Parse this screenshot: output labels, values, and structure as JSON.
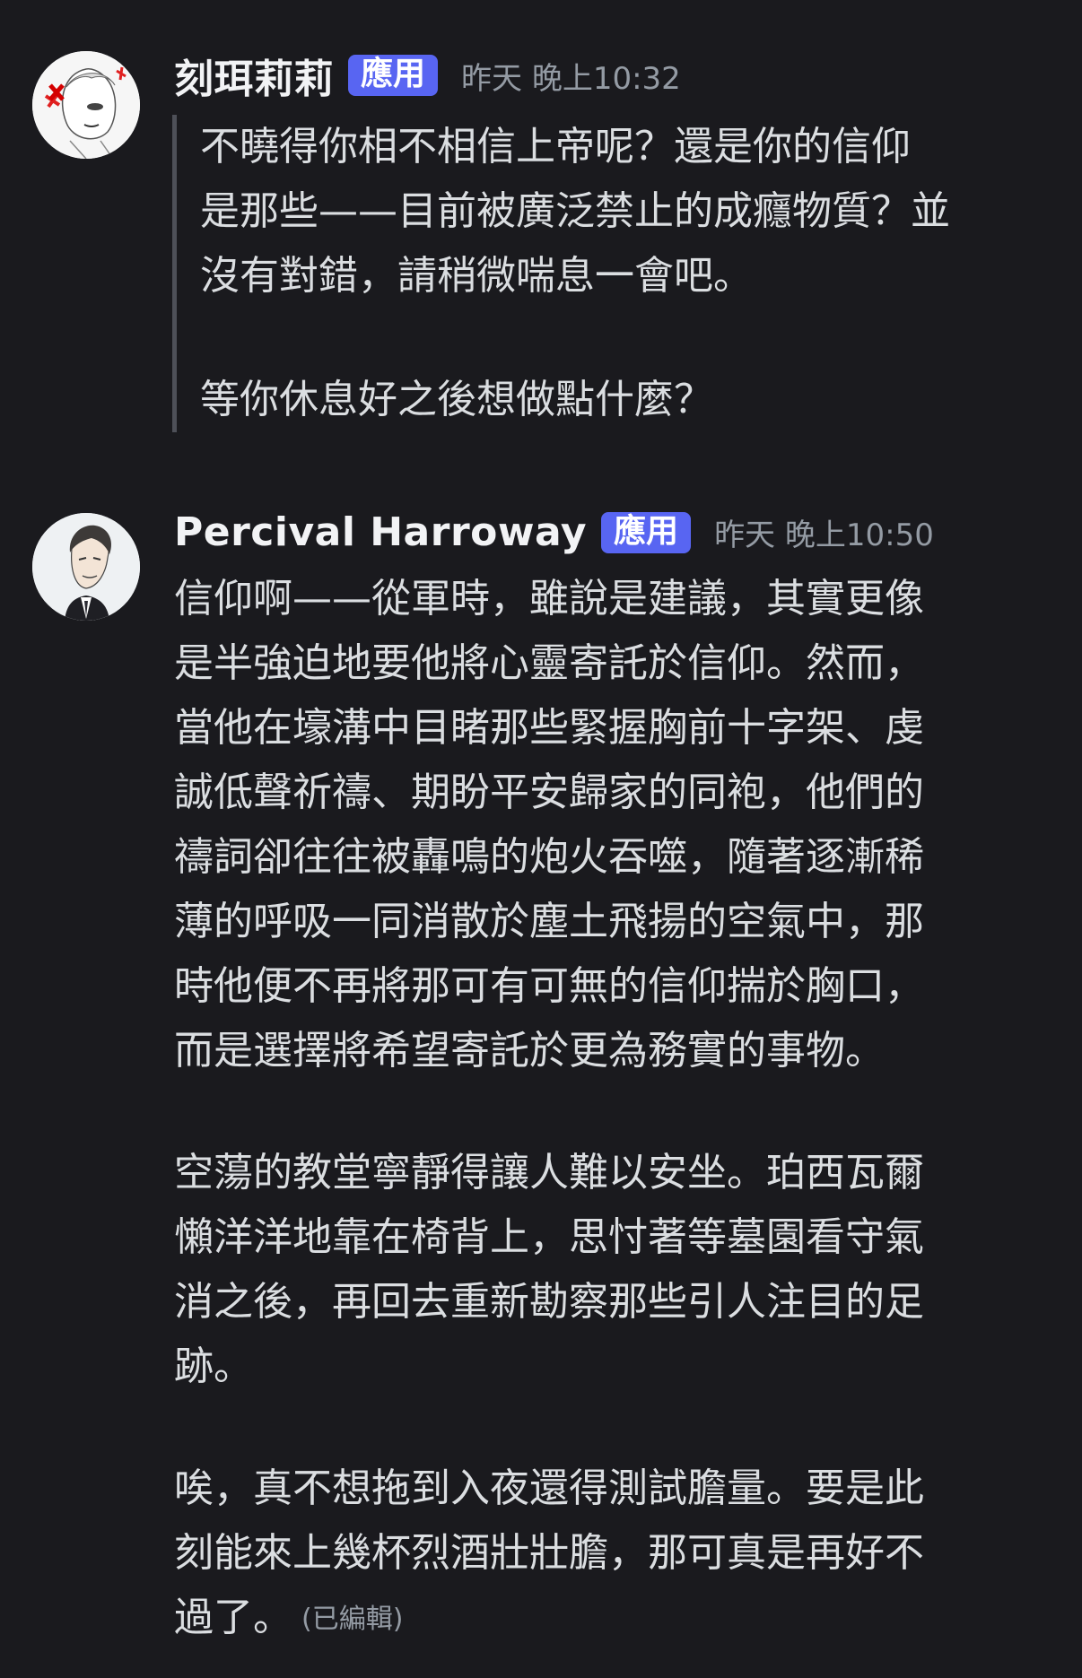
{
  "messages": [
    {
      "username": "刻珥莉莉",
      "badge": "應用",
      "timestamp": "昨天 晚上10:32",
      "quoted": true,
      "paragraphs": [
        [
          "不曉得你相不相信上帝呢？還是你的信仰",
          "是那些——目前被廣泛禁止的成癮物質？並",
          "沒有對錯，請稍微喘息一會吧。"
        ],
        [
          "等你休息好之後想做點什麼？"
        ]
      ]
    },
    {
      "username": "Percival Harroway",
      "badge": "應用",
      "timestamp": "昨天 晚上10:50",
      "quoted": false,
      "paragraphs": [
        [
          "信仰啊——從軍時，雖說是建議，其實更像",
          "是半強迫地要他將心靈寄託於信仰。然而，",
          "當他在壕溝中目睹那些緊握胸前十字架、虔",
          "誠低聲祈禱、期盼平安歸家的同袍，他們的",
          "禱詞卻往往被轟鳴的炮火吞噬，隨著逐漸稀",
          "薄的呼吸一同消散於塵土飛揚的空氣中，那",
          "時他便不再將那可有可無的信仰揣於胸口，",
          "而是選擇將希望寄託於更為務實的事物。"
        ],
        [
          "空蕩的教堂寧靜得讓人難以安坐。珀西瓦爾",
          "懶洋洋地靠在椅背上，思忖著等墓園看守氣",
          "消之後，再回去重新勘察那些引人注目的足",
          "跡。"
        ],
        [
          "唉，真不想拖到入夜還得測試膽量。要是此",
          "刻能來上幾杯烈酒壯壯膽，那可真是再好不",
          "過了。"
        ]
      ],
      "edited_label": "(已編輯)"
    }
  ]
}
